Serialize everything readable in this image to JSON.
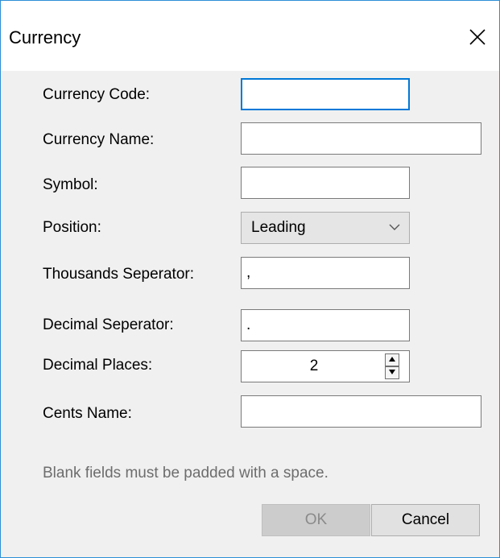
{
  "window": {
    "title": "Currency"
  },
  "form": {
    "currency_code": {
      "label": "Currency Code:",
      "value": ""
    },
    "currency_name": {
      "label": "Currency Name:",
      "value": ""
    },
    "symbol": {
      "label": "Symbol:",
      "value": ""
    },
    "position": {
      "label": "Position:",
      "value": "Leading"
    },
    "thousands_separator": {
      "label": "Thousands Seperator:",
      "value": ","
    },
    "decimal_separator": {
      "label": "Decimal Seperator:",
      "value": "."
    },
    "decimal_places": {
      "label": "Decimal Places:",
      "value": "2"
    },
    "cents_name": {
      "label": "Cents Name:",
      "value": ""
    }
  },
  "note": "Blank fields must be padded with a space.",
  "buttons": {
    "ok_label": "OK",
    "cancel_label": "Cancel"
  },
  "colors": {
    "focus_border": "#0078d7",
    "window_border": "#2b8fd6",
    "background": "#f0f0f0",
    "disabled_text": "#8a8a8a",
    "note_text": "#6d6d6d"
  },
  "icons": {
    "close": "close-icon",
    "dropdown": "chevron-down-icon",
    "spin_up": "triangle-up-icon",
    "spin_down": "triangle-down-icon"
  }
}
